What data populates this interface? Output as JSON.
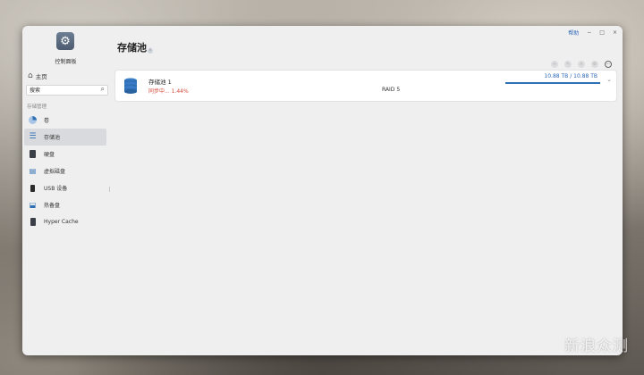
{
  "sidebar": {
    "app_title": "控制面板",
    "home_label": "主页",
    "search_placeholder": "搜索",
    "section_label": "存储管理",
    "items": [
      {
        "label": "卷"
      },
      {
        "label": "存储池"
      },
      {
        "label": "硬盘"
      },
      {
        "label": "虚拟磁盘"
      },
      {
        "label": "USB 设备"
      },
      {
        "label": "热备盘"
      },
      {
        "label": "Hyper Cache"
      }
    ]
  },
  "header": {
    "help_label": "帮助",
    "minimize_label": "−",
    "maximize_label": "□",
    "close_label": "×"
  },
  "main": {
    "title": "存储池",
    "pool": {
      "name": "存储池 1",
      "status": "同步中... 1.44%",
      "raid": "RAID 5",
      "capacity": "10.88 TB / 10.88 TB",
      "usage_fraction": 1.0
    }
  },
  "watermark": "新浪众测",
  "colors": {
    "accent": "#2f6fb3",
    "status_red": "#d64a3a"
  },
  "icons": [
    "gear-icon",
    "home-icon",
    "search-icon",
    "volume-icon",
    "storage-pool-icon",
    "hard-disk-icon",
    "virtual-disk-icon",
    "usb-device-icon",
    "hot-spare-icon",
    "hyper-cache-icon",
    "database-icon",
    "chevron-down-icon"
  ]
}
